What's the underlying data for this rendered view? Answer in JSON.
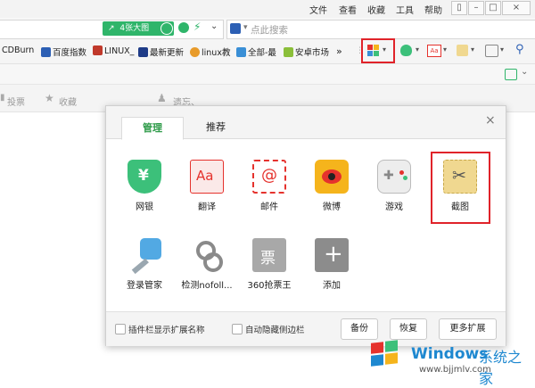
{
  "menubar": {
    "items": [
      "文件",
      "查看",
      "收藏",
      "工具",
      "帮助"
    ],
    "controls": [
      "shirt-icon",
      "minimize-icon",
      "maximize-icon",
      "close-icon"
    ]
  },
  "addressbar": {
    "bigimage_label": "4张大图",
    "search_placeholder": "点此搜索"
  },
  "bookmarks": {
    "items": [
      "CDBurn",
      "百度指数",
      "LINUX_",
      "最新更新",
      "linux教",
      "全部-最",
      "安卓市场"
    ],
    "overflow": "»"
  },
  "tabsrow": {
    "item1": "投票",
    "item2": "收藏",
    "item3": "遗忘、"
  },
  "popup": {
    "tabs": [
      "管理",
      "推荐"
    ],
    "close": "×",
    "extensions": [
      {
        "label": "网银",
        "icon": "shield-icon",
        "color": "#3cc07a"
      },
      {
        "label": "翻译",
        "icon": "translate-icon",
        "color": "#e5322d"
      },
      {
        "label": "邮件",
        "icon": "mail-icon",
        "color": "#e5322d"
      },
      {
        "label": "微博",
        "icon": "weibo-icon",
        "color": "#f5b41c"
      },
      {
        "label": "游戏",
        "icon": "gamepad-icon",
        "color": "#9a9a9a"
      },
      {
        "label": "截图",
        "icon": "scissors-icon",
        "color": "#f0d890"
      },
      {
        "label": "登录管家",
        "icon": "key-icon",
        "color": "#52a9e3"
      },
      {
        "label": "检测nofoll...",
        "icon": "chain-link-icon",
        "color": "#8a8a8a"
      },
      {
        "label": "360抢票王",
        "icon": "ticket-icon",
        "color": "#a0a0a0"
      },
      {
        "label": "添加",
        "icon": "plus-icon",
        "color": "#8c8c8c"
      }
    ],
    "ticket_char": "票",
    "translate_text": "Aa",
    "mail_text": "@",
    "footer": {
      "check1": "插件栏显示扩展名称",
      "check2": "自动隐藏侧边栏",
      "buttons": [
        "备份",
        "恢复",
        "更多扩展"
      ]
    }
  },
  "watermark": {
    "title": "Windows",
    "subtitle": "系统之家",
    "url": "www.bjjmlv.com"
  }
}
